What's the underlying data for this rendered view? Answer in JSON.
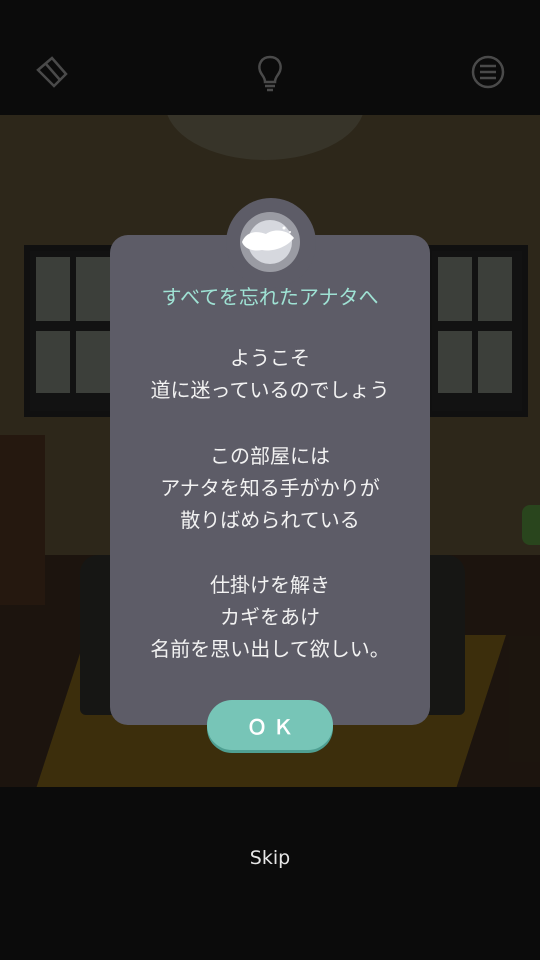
{
  "toolbar": {
    "left_icon": "item-card-icon",
    "center_icon": "lightbulb-hint-icon",
    "right_icon": "menu-icon"
  },
  "dialog": {
    "title": "すべてを忘れたアナタへ",
    "lines1": [
      "ようこそ",
      "道に迷っているのでしょう"
    ],
    "lines2": [
      "この部屋には",
      "アナタを知る手がかりが",
      "散りばめられている"
    ],
    "lines3": [
      "仕掛けを解き",
      "カギをあけ",
      "名前を思い出して欲しい。"
    ],
    "ok_label": "ＯＫ"
  },
  "skip_label": "Skip",
  "colors": {
    "dialog_bg": "#5d5c67",
    "title": "#9fe2d4",
    "ok_button": "#77c5b7"
  }
}
